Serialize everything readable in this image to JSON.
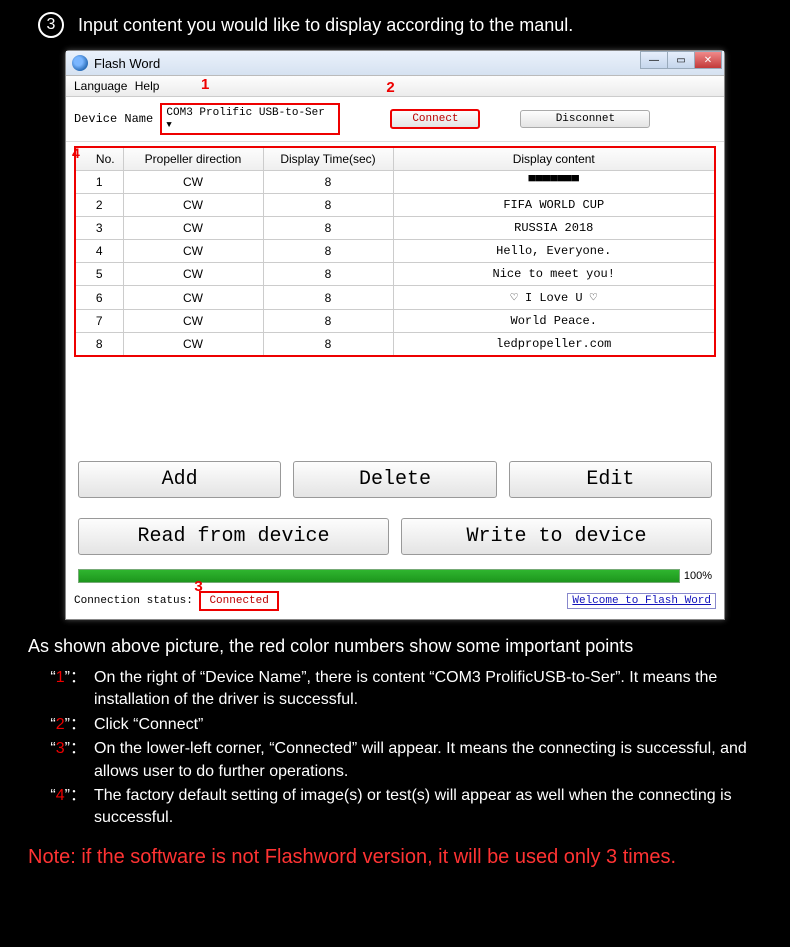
{
  "step": {
    "num": "3",
    "text": "Input content you would like to display according to the manul."
  },
  "window": {
    "title": "Flash Word",
    "menu": {
      "language": "Language",
      "help": "Help"
    },
    "device_label": "Device Name",
    "device_combo": "COM3 Prolific USB-to-Ser",
    "connect": "Connect",
    "disconnect": "Disconnet",
    "ann1": "1",
    "ann2": "2",
    "ann3": "3",
    "ann4": "4",
    "cols": {
      "no": "No.",
      "dir": "Propeller direction",
      "time": "Display Time(sec)",
      "content": "Display content"
    },
    "rows": [
      {
        "no": "1",
        "dir": "CW",
        "time": "8",
        "content": "▀▀▀▀▀▀▀"
      },
      {
        "no": "2",
        "dir": "CW",
        "time": "8",
        "content": "FIFA WORLD CUP"
      },
      {
        "no": "3",
        "dir": "CW",
        "time": "8",
        "content": "RUSSIA 2018"
      },
      {
        "no": "4",
        "dir": "CW",
        "time": "8",
        "content": "Hello, Everyone."
      },
      {
        "no": "5",
        "dir": "CW",
        "time": "8",
        "content": "Nice to meet you!"
      },
      {
        "no": "6",
        "dir": "CW",
        "time": "8",
        "content": "♡ I Love U ♡"
      },
      {
        "no": "7",
        "dir": "CW",
        "time": "8",
        "content": "World Peace."
      },
      {
        "no": "8",
        "dir": "CW",
        "time": "8",
        "content": "ledpropeller.com"
      }
    ],
    "btns": {
      "add": "Add",
      "delete": "Delete",
      "edit": "Edit",
      "read": "Read from device",
      "write": "Write to device"
    },
    "progress": "100%",
    "status_label": "Connection status:",
    "status_value": "Connected",
    "welcome": "Welcome to Flash Word"
  },
  "desc": {
    "heading": "As shown above picture, the red color numbers show some important points",
    "items": [
      {
        "n": "1",
        "t": "On the right of “Device Name”, there is content “COM3 ProlificUSB-to-Ser”. It means the installation of the driver is successful."
      },
      {
        "n": "2",
        "t": "Click “Connect”"
      },
      {
        "n": "3",
        "t": "On the lower-left corner, “Connected” will appear. It means the connecting is successful, and allows user to do further operations."
      },
      {
        "n": "4",
        "t": "The factory default setting of image(s) or test(s) will appear as well when the connecting is successful."
      }
    ]
  },
  "note": "Note: if the software is not Flashword version, it will be used only 3 times."
}
